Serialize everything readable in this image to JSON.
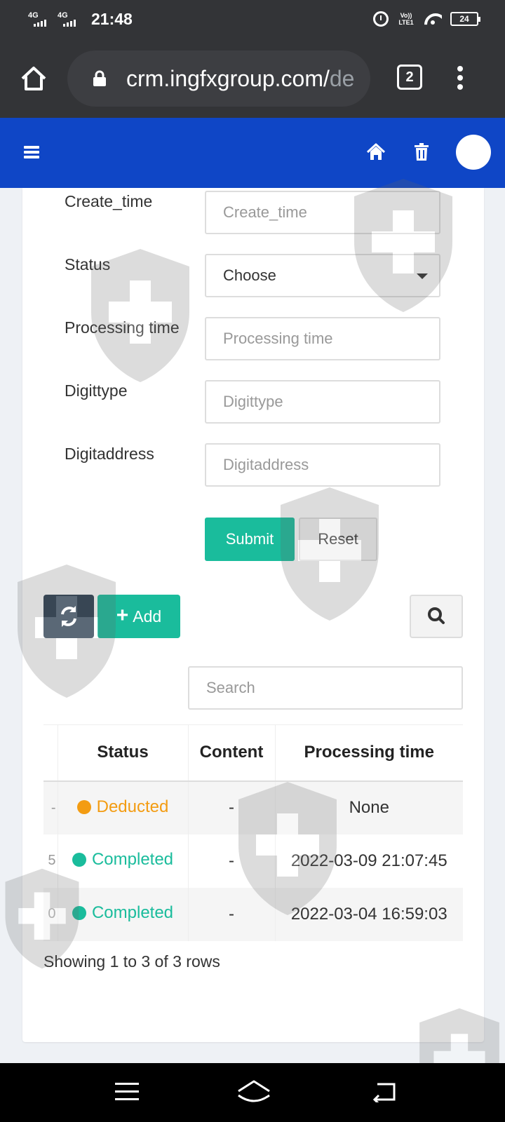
{
  "status_bar": {
    "network1": "4G",
    "network2": "4G",
    "time": "21:48",
    "volte": "Vo)) LTE1",
    "battery": "24"
  },
  "browser": {
    "url_main": "crm.ingfxgroup.com/",
    "url_faded": "de",
    "tab_count": "2"
  },
  "form": {
    "fields": [
      {
        "label": "Create_time",
        "placeholder": "Create_time"
      },
      {
        "label": "Status",
        "value": "Choose"
      },
      {
        "label": "Processing time",
        "placeholder": "Processing time"
      },
      {
        "label": "Digittype",
        "placeholder": "Digittype"
      },
      {
        "label": "Digitaddress",
        "placeholder": "Digitaddress"
      }
    ],
    "submit_label": "Submit",
    "reset_label": "Reset"
  },
  "toolbar": {
    "add_label": "Add",
    "search_placeholder": "Search"
  },
  "table": {
    "columns": [
      "Status",
      "Content",
      "Processing time"
    ],
    "rows": [
      {
        "stub": "-",
        "status": "Deducted",
        "status_color": "#f39c12",
        "content": "-",
        "processing_time": "None"
      },
      {
        "stub": "5",
        "status": "Completed",
        "status_color": "#1abc9c",
        "content": "-",
        "processing_time": "2022-03-09 21:07:45"
      },
      {
        "stub": "0",
        "status": "Completed",
        "status_color": "#1abc9c",
        "content": "-",
        "processing_time": "2022-03-04 16:59:03"
      }
    ]
  },
  "pagination": {
    "info": "Showing 1 to 3 of 3 rows"
  },
  "colors": {
    "header_blue": "#0f46c6",
    "accent_green": "#1abc9c",
    "deducted_orange": "#f39c12",
    "refresh_dark": "#2c3e50"
  }
}
